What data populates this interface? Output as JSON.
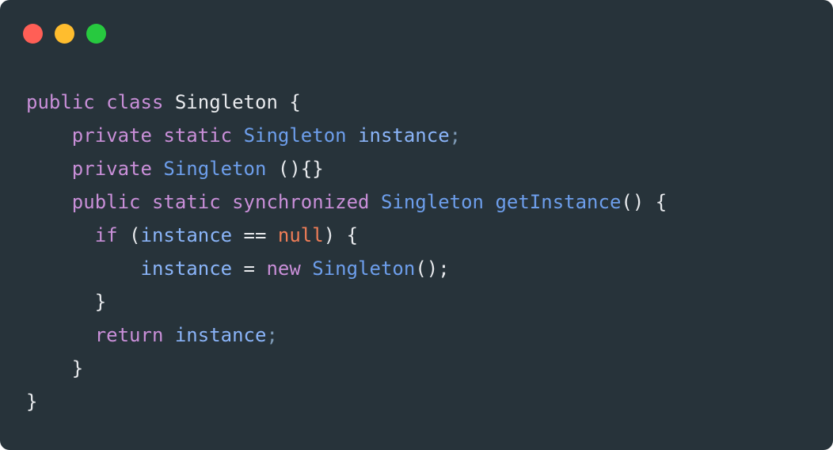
{
  "window": {
    "title": "",
    "background_color": "#27333a",
    "controls": [
      {
        "name": "close",
        "color": "#ff5f56"
      },
      {
        "name": "minimize",
        "color": "#ffbd2e"
      },
      {
        "name": "maximize",
        "color": "#27c93f"
      }
    ]
  },
  "theme": {
    "keyword_color": "#c98fd8",
    "type_color": "#6d9eeb",
    "function_color": "#6d9eeb",
    "variable_color": "#8ab4f8",
    "plain_color": "#e8eaed",
    "punctuation_color": "#7e9ab5",
    "literal_color": "#ef7d57"
  },
  "code": {
    "language": "java",
    "plain_text": "public class Singleton {\n    private static Singleton instance;\n    private Singleton (){}\n    public static synchronized Singleton getInstance() {\n      if (instance == null) {\n          instance = new Singleton();\n      }\n      return instance;\n    }\n}",
    "lines": [
      {
        "indent": "",
        "tokens": [
          {
            "text": "public",
            "kind": "keyword"
          },
          {
            "text": " ",
            "kind": "plain"
          },
          {
            "text": "class",
            "kind": "keyword"
          },
          {
            "text": " ",
            "kind": "plain"
          },
          {
            "text": "Singleton",
            "kind": "plain"
          },
          {
            "text": " ",
            "kind": "plain"
          },
          {
            "text": "{",
            "kind": "plain"
          }
        ]
      },
      {
        "indent": "    ",
        "tokens": [
          {
            "text": "private",
            "kind": "keyword"
          },
          {
            "text": " ",
            "kind": "plain"
          },
          {
            "text": "static",
            "kind": "keyword"
          },
          {
            "text": " ",
            "kind": "plain"
          },
          {
            "text": "Singleton",
            "kind": "type"
          },
          {
            "text": " ",
            "kind": "plain"
          },
          {
            "text": "instance",
            "kind": "variable"
          },
          {
            "text": ";",
            "kind": "punctuation"
          }
        ]
      },
      {
        "indent": "    ",
        "tokens": [
          {
            "text": "private",
            "kind": "keyword"
          },
          {
            "text": " ",
            "kind": "plain"
          },
          {
            "text": "Singleton",
            "kind": "type"
          },
          {
            "text": " ",
            "kind": "plain"
          },
          {
            "text": "(){}",
            "kind": "plain"
          }
        ]
      },
      {
        "indent": "    ",
        "tokens": [
          {
            "text": "public",
            "kind": "keyword"
          },
          {
            "text": " ",
            "kind": "plain"
          },
          {
            "text": "static",
            "kind": "keyword"
          },
          {
            "text": " ",
            "kind": "plain"
          },
          {
            "text": "synchronized",
            "kind": "keyword"
          },
          {
            "text": " ",
            "kind": "plain"
          },
          {
            "text": "Singleton",
            "kind": "type"
          },
          {
            "text": " ",
            "kind": "plain"
          },
          {
            "text": "getInstance",
            "kind": "function"
          },
          {
            "text": "() {",
            "kind": "plain"
          }
        ]
      },
      {
        "indent": "      ",
        "tokens": [
          {
            "text": "if",
            "kind": "keyword"
          },
          {
            "text": " (",
            "kind": "plain"
          },
          {
            "text": "instance",
            "kind": "variable"
          },
          {
            "text": " == ",
            "kind": "plain"
          },
          {
            "text": "null",
            "kind": "literal"
          },
          {
            "text": ") {",
            "kind": "plain"
          }
        ]
      },
      {
        "indent": "          ",
        "tokens": [
          {
            "text": "instance",
            "kind": "variable"
          },
          {
            "text": " = ",
            "kind": "plain"
          },
          {
            "text": "new",
            "kind": "keyword"
          },
          {
            "text": " ",
            "kind": "plain"
          },
          {
            "text": "Singleton",
            "kind": "type"
          },
          {
            "text": "();",
            "kind": "plain"
          }
        ]
      },
      {
        "indent": "      ",
        "tokens": [
          {
            "text": "}",
            "kind": "plain"
          }
        ]
      },
      {
        "indent": "      ",
        "tokens": [
          {
            "text": "return",
            "kind": "keyword"
          },
          {
            "text": " ",
            "kind": "plain"
          },
          {
            "text": "instance",
            "kind": "variable"
          },
          {
            "text": ";",
            "kind": "punctuation"
          }
        ]
      },
      {
        "indent": "    ",
        "tokens": [
          {
            "text": "}",
            "kind": "plain"
          }
        ]
      },
      {
        "indent": "",
        "tokens": [
          {
            "text": "}",
            "kind": "plain"
          }
        ]
      }
    ]
  }
}
